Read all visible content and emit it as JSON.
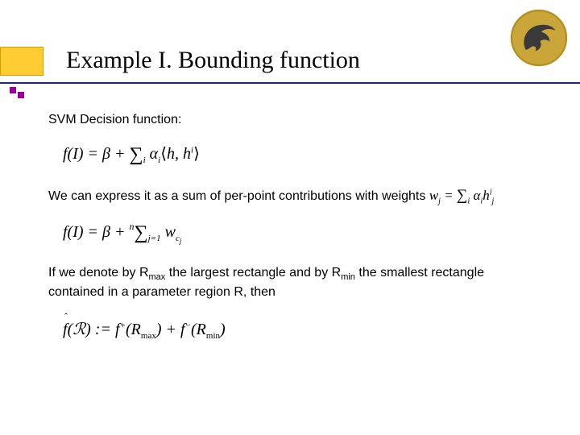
{
  "title": "Example I. Bounding function",
  "body": {
    "p1": "SVM Decision function:",
    "p2_a": "We can express it as a sum of per-point contributions with weights ",
    "p3_a": "If we denote by R",
    "p3_max": "max",
    "p3_b": " the largest rectangle and by R",
    "p3_min": "min",
    "p3_c": " the smallest rectangle contained in a parameter region R, then"
  },
  "formula1": {
    "lhs": "f(I) = β + ",
    "sum_sub": "i",
    "alpha": "α",
    "ai": "i",
    "h1": "h, h",
    "hi": "i"
  },
  "weights": {
    "w": "w",
    "j": "j",
    "eq": " = ",
    "sum_sub": "i",
    "alpha": " α",
    "ai": "i",
    "h": "h",
    "hj": "j",
    "hi": "i"
  },
  "formula2": {
    "lhs": "f(I) = β + ",
    "sum_upper": "n",
    "sum_lower": "j=1",
    "w": " w",
    "c": "c",
    "j": "j"
  },
  "formula3": {
    "fhat": "f",
    "R": "(ℛ) := f",
    "plus": "+",
    "Rmax_a": "(R",
    "max": "max",
    "paren": ") + f",
    "minus": "−",
    "Rmin_a": "(R",
    "min": "min",
    "close": ")"
  },
  "icons": {
    "logo": "pegasus-seal-icon"
  }
}
